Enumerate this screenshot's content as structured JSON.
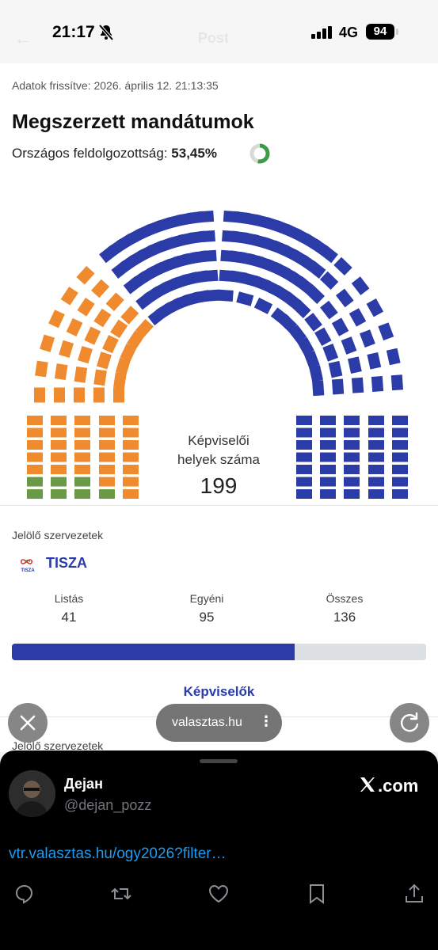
{
  "status_bar": {
    "time": "21:17",
    "network": "4G",
    "battery": "94",
    "ghost_title": "Post"
  },
  "page": {
    "updated": "Adatok frissítve: 2026. április 12. 21:13:35",
    "heading": "Megszerzett mandátumok",
    "progress_label": "Országos feldolgozottság: ",
    "progress_value": "53,45%",
    "progress_fraction": 0.5345,
    "seat_caption_line1": "Képviselői",
    "seat_caption_line2": "helyek száma",
    "seat_total": "199",
    "section_label": "Jelölő szervezetek",
    "party": {
      "logo_text": "TISZA",
      "name": "TISZA",
      "color": "#2b3ba8",
      "stats": [
        {
          "label": "Listás",
          "value": "41"
        },
        {
          "label": "Egyéni",
          "value": "95"
        },
        {
          "label": "Összes",
          "value": "136"
        }
      ],
      "bar_fraction": 0.683
    },
    "representatives_link": "Képviselők",
    "section_label_2": "Jelölő szervezetek",
    "colors": {
      "tisza": "#2b3ba8",
      "orange": "#ef8a2e",
      "green": "#6a9a45",
      "accent_link": "#2b3ba8"
    }
  },
  "browser": {
    "url_pill": "valasztas.hu",
    "menu_glyph": "⋮",
    "close_icon": "close-icon",
    "reload_icon": "reload-icon"
  },
  "tweet": {
    "user_name": "Дејан",
    "user_handle": "@dejan_pozz",
    "brand": "X.com",
    "brand_suffix": ".com",
    "link": "vtr.valasztas.hu/ogy2026?filter…",
    "actions": [
      "reply-icon",
      "retweet-icon",
      "like-icon",
      "bookmark-icon",
      "share-icon"
    ]
  }
}
